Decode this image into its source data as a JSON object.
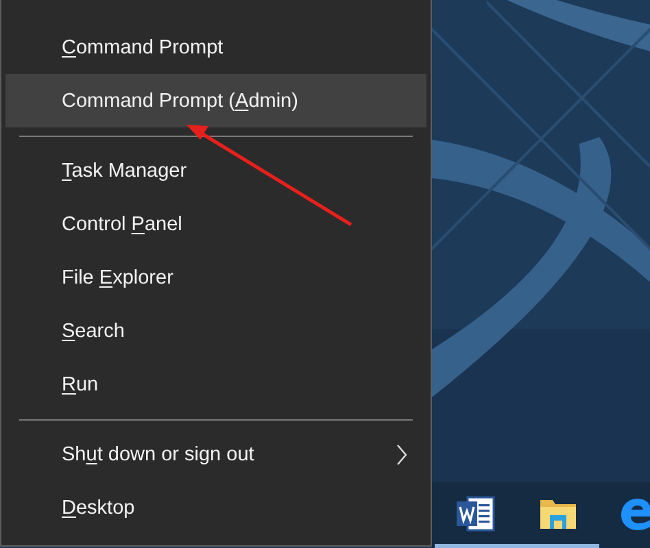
{
  "menu": {
    "items": [
      {
        "kind": "item",
        "key": "C",
        "after": "ommand Prompt",
        "selected": false,
        "has_submenu": false
      },
      {
        "kind": "item",
        "before": "Command Prompt (",
        "key": "A",
        "after": "dmin)",
        "selected": true,
        "has_submenu": false
      },
      {
        "kind": "separator"
      },
      {
        "kind": "item",
        "key": "T",
        "after": "ask Manager",
        "selected": false,
        "has_submenu": false
      },
      {
        "kind": "item",
        "before": "Control ",
        "key": "P",
        "after": "anel",
        "selected": false,
        "has_submenu": false
      },
      {
        "kind": "item",
        "before": "File ",
        "key": "E",
        "after": "xplorer",
        "selected": false,
        "has_submenu": false
      },
      {
        "kind": "item",
        "key": "S",
        "after": "earch",
        "selected": false,
        "has_submenu": false
      },
      {
        "kind": "item",
        "key": "R",
        "after": "un",
        "selected": false,
        "has_submenu": false
      },
      {
        "kind": "separator"
      },
      {
        "kind": "item",
        "before": "Sh",
        "key": "u",
        "after": "t down or sign out",
        "selected": false,
        "has_submenu": true
      },
      {
        "kind": "item",
        "key": "D",
        "after": "esktop",
        "selected": false,
        "has_submenu": false
      }
    ]
  },
  "taskbar": {
    "apps": [
      {
        "kind": "word",
        "running": true
      },
      {
        "kind": "folder",
        "running": true
      },
      {
        "kind": "browser",
        "running": false
      }
    ]
  }
}
